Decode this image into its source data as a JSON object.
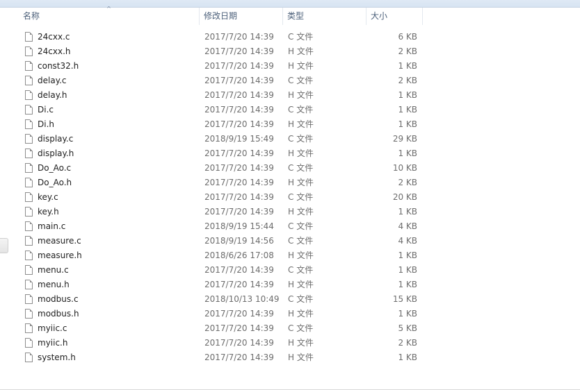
{
  "columns": {
    "name": "名称",
    "date": "修改日期",
    "type": "类型",
    "size": "大小",
    "sort_arrow": "^"
  },
  "files": [
    {
      "name": "24cxx.c",
      "date": "2017/7/20 14:39",
      "type": "C 文件",
      "size": "6 KB"
    },
    {
      "name": "24cxx.h",
      "date": "2017/7/20 14:39",
      "type": "H 文件",
      "size": "2 KB"
    },
    {
      "name": "const32.h",
      "date": "2017/7/20 14:39",
      "type": "H 文件",
      "size": "1 KB"
    },
    {
      "name": "delay.c",
      "date": "2017/7/20 14:39",
      "type": "C 文件",
      "size": "2 KB"
    },
    {
      "name": "delay.h",
      "date": "2017/7/20 14:39",
      "type": "H 文件",
      "size": "1 KB"
    },
    {
      "name": "Di.c",
      "date": "2017/7/20 14:39",
      "type": "C 文件",
      "size": "1 KB"
    },
    {
      "name": "Di.h",
      "date": "2017/7/20 14:39",
      "type": "H 文件",
      "size": "1 KB"
    },
    {
      "name": "display.c",
      "date": "2018/9/19 15:49",
      "type": "C 文件",
      "size": "29 KB"
    },
    {
      "name": "display.h",
      "date": "2017/7/20 14:39",
      "type": "H 文件",
      "size": "1 KB"
    },
    {
      "name": "Do_Ao.c",
      "date": "2017/7/20 14:39",
      "type": "C 文件",
      "size": "10 KB"
    },
    {
      "name": "Do_Ao.h",
      "date": "2017/7/20 14:39",
      "type": "H 文件",
      "size": "2 KB"
    },
    {
      "name": "key.c",
      "date": "2017/7/20 14:39",
      "type": "C 文件",
      "size": "20 KB"
    },
    {
      "name": "key.h",
      "date": "2017/7/20 14:39",
      "type": "H 文件",
      "size": "1 KB"
    },
    {
      "name": "main.c",
      "date": "2018/9/19 15:44",
      "type": "C 文件",
      "size": "4 KB"
    },
    {
      "name": "measure.c",
      "date": "2018/9/19 14:56",
      "type": "C 文件",
      "size": "4 KB"
    },
    {
      "name": "measure.h",
      "date": "2018/6/26 17:08",
      "type": "H 文件",
      "size": "1 KB"
    },
    {
      "name": "menu.c",
      "date": "2017/7/20 14:39",
      "type": "C 文件",
      "size": "1 KB"
    },
    {
      "name": "menu.h",
      "date": "2017/7/20 14:39",
      "type": "H 文件",
      "size": "1 KB"
    },
    {
      "name": "modbus.c",
      "date": "2018/10/13 10:49",
      "type": "C 文件",
      "size": "15 KB"
    },
    {
      "name": "modbus.h",
      "date": "2017/7/20 14:39",
      "type": "H 文件",
      "size": "1 KB"
    },
    {
      "name": "myiic.c",
      "date": "2017/7/20 14:39",
      "type": "C 文件",
      "size": "5 KB"
    },
    {
      "name": "myiic.h",
      "date": "2017/7/20 14:39",
      "type": "H 文件",
      "size": "2 KB"
    },
    {
      "name": "system.h",
      "date": "2017/7/20 14:39",
      "type": "H 文件",
      "size": "1 KB"
    }
  ],
  "icons": {
    "file": "file-icon"
  },
  "colors": {
    "header_text": "#4c607a",
    "detail_text": "#6d6d6d",
    "name_text": "#1e1e1e"
  }
}
